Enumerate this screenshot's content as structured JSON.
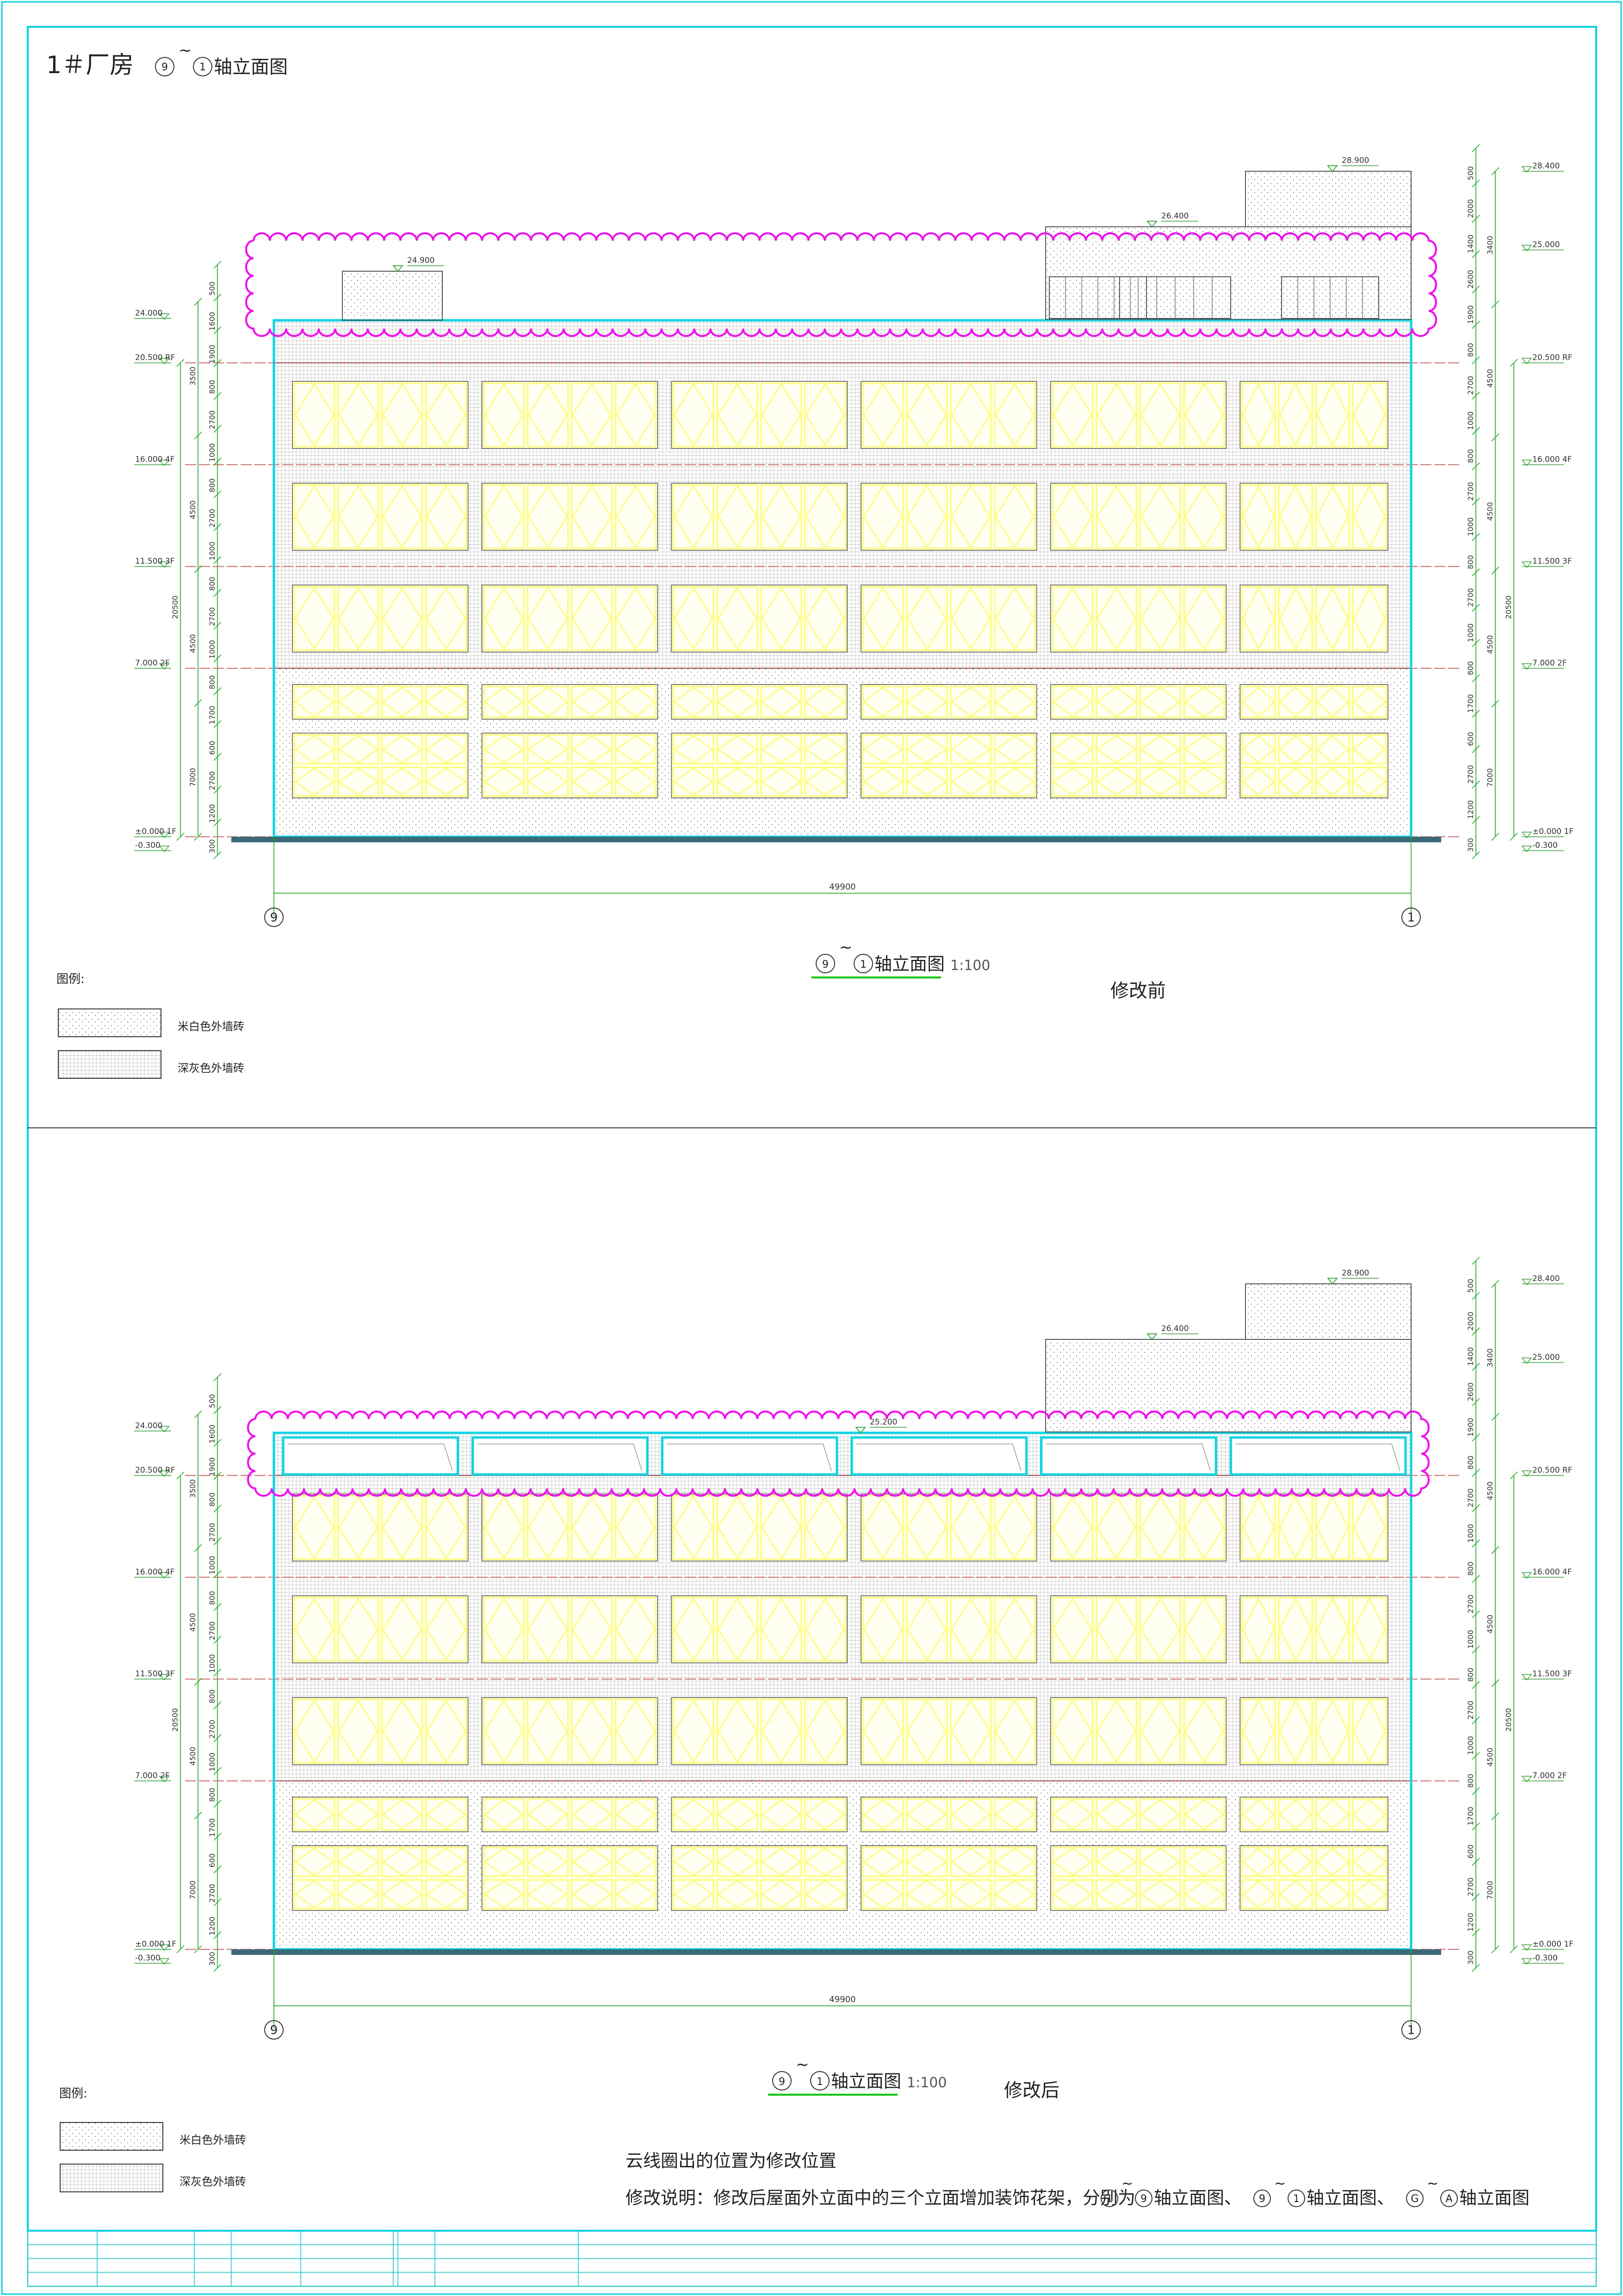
{
  "sheet_title": "1＃厂房",
  "sheet_title_axis": {
    "from": "9",
    "to": "1",
    "suffix": "轴立面图"
  },
  "legend_title": "图例:",
  "legend_items": [
    {
      "label": "米白色外墙砖"
    },
    {
      "label": "深灰色外墙砖"
    }
  ],
  "panels": [
    {
      "id": "before",
      "caption": {
        "from": "9",
        "to": "1",
        "suffix": "轴立面图",
        "scale": "1:100"
      },
      "state_label": "修改前",
      "overall_dim": "49900",
      "grid_left": "9",
      "grid_right": "1",
      "parapet_level": "24.900",
      "stair_level": "26.400",
      "top_level": "28.900",
      "left_levels": [
        "24.000",
        "20.500 RF",
        "16.000 4F",
        "11.500 3F",
        "7.000 2F",
        "±0.000 1F",
        "-0.300"
      ],
      "right_levels": [
        "28.400",
        "25.000",
        "20.500 RF",
        "16.000 4F",
        "11.500 3F",
        "7.000 2F",
        "±0.000 1F",
        "-0.300"
      ],
      "left_dims_a": [
        "500",
        "1600",
        "1900",
        "800",
        "2700",
        "1000",
        "800",
        "2700",
        "1000",
        "800",
        "2700",
        "1000",
        "800",
        "1700",
        "600",
        "2700",
        "1200",
        "300"
      ],
      "left_dims_b": [
        "3500",
        "4500",
        "4500",
        "7000"
      ],
      "left_dims_total": "20500",
      "right_dims_a": [
        "500",
        "2000",
        "1400",
        "2600",
        "1900",
        "800",
        "2700",
        "1000",
        "800",
        "2700",
        "1000",
        "800",
        "2700",
        "1000",
        "800",
        "1700",
        "600",
        "2700",
        "1200",
        "300"
      ],
      "right_dims_b": [
        "3400",
        "4500",
        "4500",
        "4500",
        "7000"
      ],
      "right_dims_total": "20500"
    },
    {
      "id": "after",
      "caption": {
        "from": "9",
        "to": "1",
        "suffix": "轴立面图",
        "scale": "1:100"
      },
      "state_label": "修改后",
      "overall_dim": "49900",
      "grid_left": "9",
      "grid_right": "1",
      "frame_level": "25.200",
      "stair_level": "26.400",
      "top_level": "28.900",
      "left_levels": [
        "24.000",
        "20.500 RF",
        "16.000 4F",
        "11.500 3F",
        "7.000 2F",
        "±0.000 1F",
        "-0.300"
      ],
      "right_levels": [
        "28.400",
        "25.000",
        "20.500 RF",
        "16.000 4F",
        "11.500 3F",
        "7.000 2F",
        "±0.000 1F",
        "-0.300"
      ],
      "left_dims_a": [
        "500",
        "1600",
        "1900",
        "800",
        "2700",
        "1000",
        "800",
        "2700",
        "1000",
        "800",
        "2700",
        "1000",
        "800",
        "1700",
        "600",
        "2700",
        "1200",
        "300"
      ],
      "left_dims_b": [
        "3500",
        "4500",
        "4500",
        "7000"
      ],
      "left_dims_total": "20500",
      "right_dims_a": [
        "500",
        "2000",
        "1400",
        "2600",
        "1900",
        "800",
        "2700",
        "1000",
        "800",
        "2700",
        "1000",
        "800",
        "2700",
        "1000",
        "800",
        "1700",
        "600",
        "2700",
        "1200",
        "300"
      ],
      "right_dims_b": [
        "3400",
        "4500",
        "4500",
        "4500",
        "7000"
      ],
      "right_dims_total": "20500"
    }
  ],
  "notes": {
    "line1": "云线圈出的位置为修改位置",
    "line2_prefix": "修改说明：修改后屋面外立面中的三个立面增加装饰花架，分别为",
    "line2_refs": [
      {
        "from": "1",
        "to": "9",
        "suffix": "轴立面图、"
      },
      {
        "from": "9",
        "to": "1",
        "suffix": "轴立面图、"
      },
      {
        "from": "G",
        "to": "A",
        "suffix": "轴立面图"
      }
    ]
  },
  "colors": {
    "frame": "#00d8e8",
    "cloud": "#ff00ff",
    "window": "#ffff66",
    "dim_line": "#00bb00",
    "level_line": "#ff3333",
    "ground": "#3a6a78",
    "hatch": "#888888"
  }
}
